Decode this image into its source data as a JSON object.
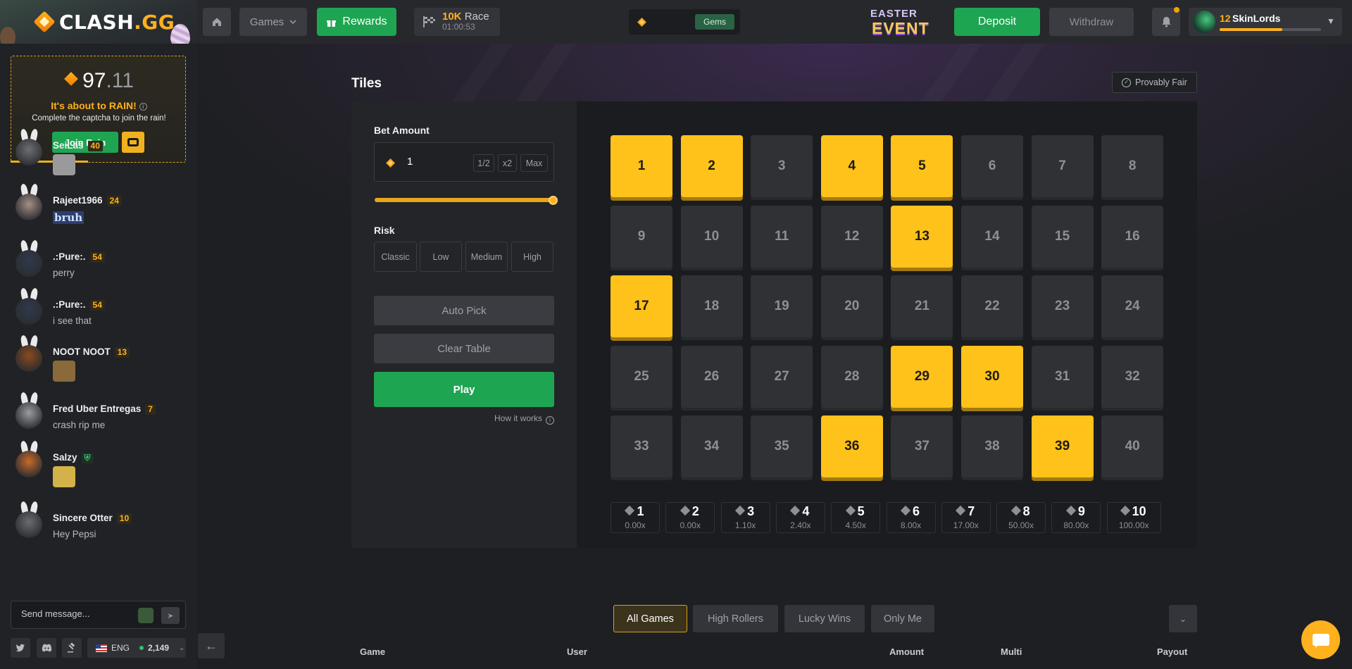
{
  "brand": {
    "name_main": "CLASH",
    "name_suffix": ".GG"
  },
  "nav": {
    "games_label": "Games",
    "rewards_label": "Rewards",
    "race": {
      "amount": "10K",
      "label": "Race",
      "timer": "01:00:53"
    },
    "gems_label": "Gems",
    "event": {
      "line1": "EASTER",
      "line2": "EVENT"
    },
    "deposit_label": "Deposit",
    "withdraw_label": "Withdraw"
  },
  "user": {
    "level": "12",
    "name": "SkinLords",
    "xp_progress": 0.62
  },
  "rain": {
    "amount_int": "97",
    "amount_dec": ".11",
    "title": "It's about to RAIN!",
    "subtitle": "Complete the captcha to join the rain!",
    "join_label": "Join Rain",
    "progress": 0.44
  },
  "chat": {
    "messages": [
      {
        "user": "SeiLas",
        "level": "40",
        "text": "",
        "emote": true
      },
      {
        "user": "Rajeet1966",
        "level": "24",
        "text": "bruh",
        "emote": false
      },
      {
        "user": ".:Pure:.",
        "level": "54",
        "text": "perry",
        "emote": false
      },
      {
        "user": ".:Pure:.",
        "level": "54",
        "text": "i see that",
        "emote": false
      },
      {
        "user": "NOOT NOOT",
        "level": "13",
        "text": "",
        "emote": true
      },
      {
        "user": "Fred Uber Entregas",
        "level": "7",
        "text": "crash rip me",
        "emote": false
      },
      {
        "user": "Salzy",
        "level": "",
        "text": "",
        "emote": true
      },
      {
        "user": "Sincere Otter",
        "level": "10",
        "text": "Hey Pepsi",
        "emote": false
      }
    ],
    "input_placeholder": "Send message...",
    "language": "ENG",
    "online_count": "2,149"
  },
  "game": {
    "title": "Tiles",
    "provably_fair_label": "Provably Fair",
    "bet_label": "Bet Amount",
    "bet_value": "1",
    "half_label": "1/2",
    "double_label": "x2",
    "max_label": "Max",
    "bet_slider": 1.0,
    "risk_label": "Risk",
    "risk_options": [
      "Classic",
      "Low",
      "Medium",
      "High"
    ],
    "risk_selected": "Classic",
    "auto_pick_label": "Auto Pick",
    "clear_label": "Clear Table",
    "play_label": "Play",
    "how_it_works_label": "How it works",
    "tiles": [
      1,
      2,
      3,
      4,
      5,
      6,
      7,
      8,
      9,
      10,
      11,
      12,
      13,
      14,
      15,
      16,
      17,
      18,
      19,
      20,
      21,
      22,
      23,
      24,
      25,
      26,
      27,
      28,
      29,
      30,
      31,
      32,
      33,
      34,
      35,
      36,
      37,
      38,
      39,
      40
    ],
    "selected_tiles": [
      1,
      2,
      4,
      5,
      13,
      17,
      29,
      30,
      36,
      39
    ],
    "payouts": [
      {
        "hits": "1",
        "multiplier": "0.00x"
      },
      {
        "hits": "2",
        "multiplier": "0.00x"
      },
      {
        "hits": "3",
        "multiplier": "1.10x"
      },
      {
        "hits": "4",
        "multiplier": "2.40x"
      },
      {
        "hits": "5",
        "multiplier": "4.50x"
      },
      {
        "hits": "6",
        "multiplier": "8.00x"
      },
      {
        "hits": "7",
        "multiplier": "17.00x"
      },
      {
        "hits": "8",
        "multiplier": "50.00x"
      },
      {
        "hits": "9",
        "multiplier": "80.00x"
      },
      {
        "hits": "10",
        "multiplier": "100.00x"
      }
    ]
  },
  "bets": {
    "tabs": [
      "All Games",
      "High Rollers",
      "Lucky Wins",
      "Only Me"
    ],
    "columns": [
      "Game",
      "User",
      "Amount",
      "Multi",
      "Payout"
    ]
  },
  "colors": {
    "accent": "#ffb11e",
    "green": "#1ea552",
    "tile_selected": "#ffc21a",
    "background": "#1d1f22"
  }
}
